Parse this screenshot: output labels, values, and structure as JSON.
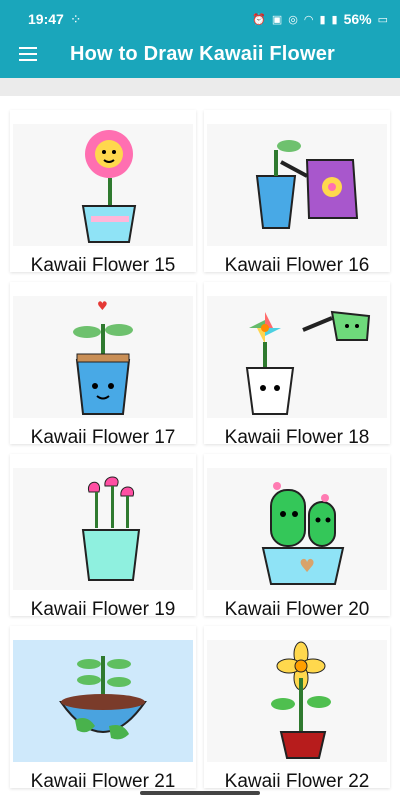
{
  "status_bar": {
    "time": "19:47",
    "battery": "56%",
    "colors": {
      "bar": "#1aa6bb"
    }
  },
  "app_bar": {
    "title": "How to Draw Kawaii Flower",
    "menu_icon": "hamburger-menu-icon"
  },
  "items": [
    {
      "label": "Kawaii Flower 15",
      "icon": "smiling-daisy-pot-image"
    },
    {
      "label": "Kawaii Flower 16",
      "icon": "watering-can-seedling-image"
    },
    {
      "label": "Kawaii Flower 17",
      "icon": "sprout-heart-pot-image"
    },
    {
      "label": "Kawaii Flower 18",
      "icon": "pinwheel-flower-watering-image"
    },
    {
      "label": "Kawaii Flower 19",
      "icon": "tulip-bouquet-pot-image"
    },
    {
      "label": "Kawaii Flower 20",
      "icon": "cactus-heart-pot-image"
    },
    {
      "label": "Kawaii Flower 21",
      "icon": "earth-bowl-sprout-image"
    },
    {
      "label": "Kawaii Flower 22",
      "icon": "yellow-flower-pot-image"
    }
  ]
}
